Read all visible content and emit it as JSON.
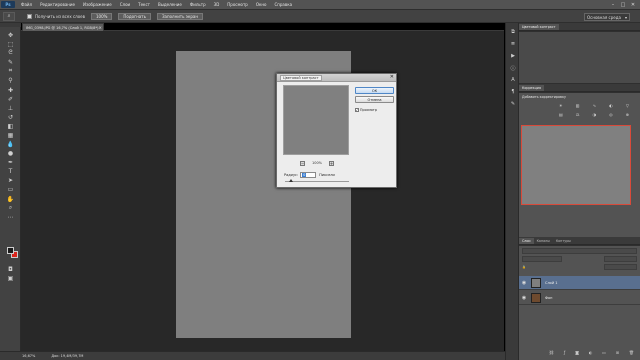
{
  "app": {
    "logo": "Ps"
  },
  "menu": [
    "Файл",
    "Редактирование",
    "Изображение",
    "Слои",
    "Текст",
    "Выделение",
    "Фильтр",
    "3D",
    "Просмотр",
    "Окно",
    "Справка"
  ],
  "window_buttons": [
    "–",
    "□",
    "✕"
  ],
  "options": {
    "checkbox_label": "Получить из всех слоев",
    "zoom": "100%",
    "fit_button": "Подогнать",
    "fill_button": "Заполнить экран",
    "workspace": "Основная среда"
  },
  "document": {
    "tab_title": "IMG_0398.JPG @ 16,7% (Слой 1, RGB/8*)",
    "close": "×",
    "zoom_status": "16,67%",
    "doc_status": "Док: 19,4M/39,7M"
  },
  "dialog": {
    "title": "Цветовой контраст",
    "close": "✕",
    "ok_label": "ОК",
    "cancel_label": "Отмена",
    "preview_label": "Просмотр",
    "preview_checked": "✓",
    "zoom_value": "100%",
    "zoom_minus": "−",
    "zoom_plus": "+",
    "radius_label": "Радиус:",
    "radius_value": "0",
    "radius_unit": "Пиксели",
    "radius_slider_fraction": 0.1
  },
  "panels": {
    "top_tabs": [
      "Цветовой контраст"
    ],
    "adjustments_tabs": [
      "Коррекция"
    ],
    "adjustments_title": "Добавить корректировку",
    "layers_tabs": [
      "Слои",
      "Каналы",
      "Контуры"
    ],
    "layers": [
      {
        "name": "Слой 1",
        "selected": true
      },
      {
        "name": "Фон",
        "selected": false
      }
    ]
  },
  "colors": {
    "foreground": "#1b1b1b",
    "background": "#d9241c",
    "document_fill": "#7f7f7f",
    "selected_layer": "#596f8f"
  }
}
